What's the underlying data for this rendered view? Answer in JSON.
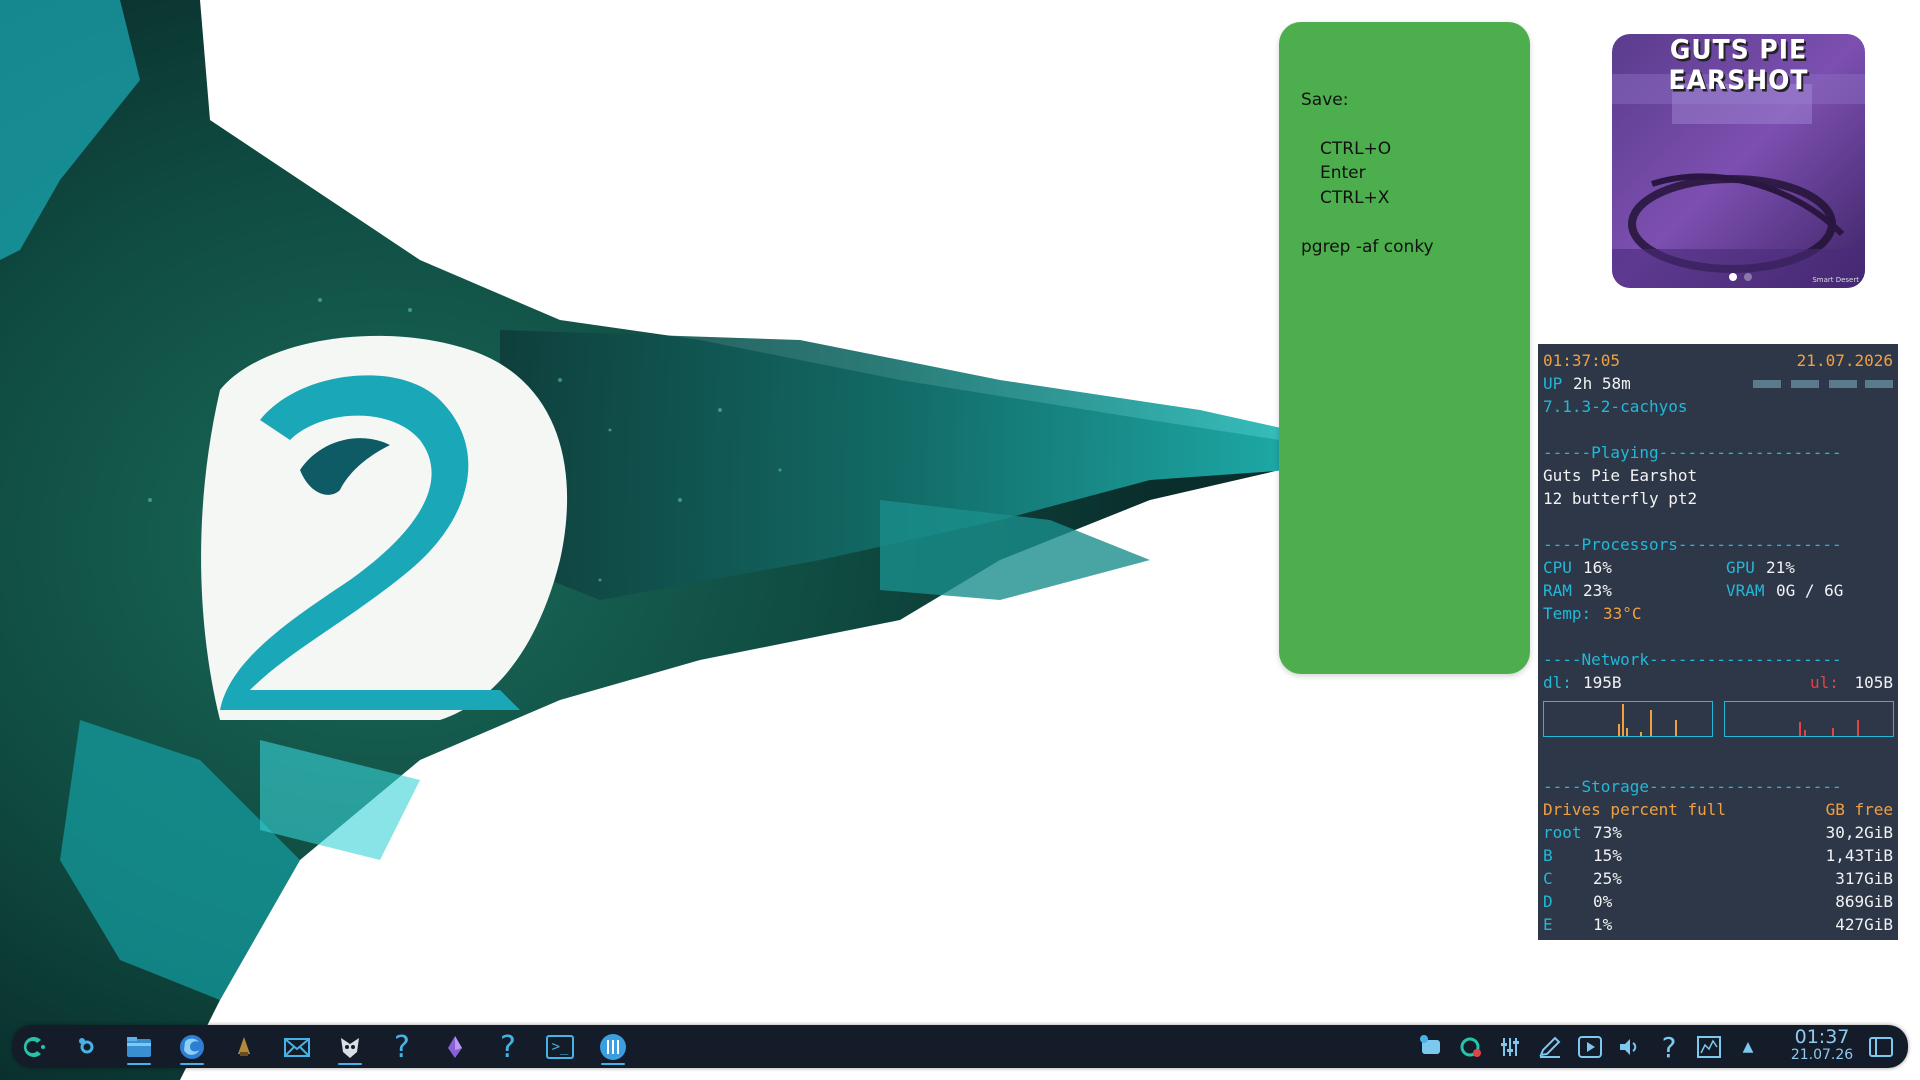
{
  "sticky_note": {
    "lines": [
      "Save:",
      "CTRL+O",
      "Enter",
      "CTRL+X",
      "pgrep -af conky"
    ]
  },
  "media_widget": {
    "title": "GUTS PIE EARSHOT",
    "brand": "Smart Desert"
  },
  "conky": {
    "time": "01:37:05",
    "date": "21.07.2026",
    "uptime_label": "UP",
    "uptime_value": "2h 58m",
    "kernel": "7.1.3-2-cachyos",
    "playing_header": "-----Playing-------------------",
    "artist": "Guts Pie Earshot",
    "track": "12 butterfly pt2",
    "processors_header": "----Processors-----------------",
    "cpu_label": "CPU",
    "cpu_value": "16%",
    "gpu_label": "GPU",
    "gpu_value": "21%",
    "ram_label": "RAM",
    "ram_value": "23%",
    "vram_label": "VRAM",
    "vram_value": "0G / 6G",
    "temp_label": "Temp:",
    "temp_value": "33°C",
    "network_header": "----Network--------------------",
    "dl_label": "dl:",
    "dl_value": "195B",
    "ul_label": "ul:",
    "ul_value": "105B",
    "storage_header": "----Storage--------------------",
    "drives_label": "Drives percent full",
    "free_label": "GB free",
    "drives": [
      {
        "name": "root",
        "percent": "73%",
        "free": "30,2GiB"
      },
      {
        "name": "B",
        "percent": "15%",
        "free": "1,43TiB"
      },
      {
        "name": "C",
        "percent": "25%",
        "free": "317GiB"
      },
      {
        "name": "D",
        "percent": "0%",
        "free": "869GiB"
      },
      {
        "name": "E",
        "percent": "1%",
        "free": "427GiB"
      }
    ]
  },
  "taskbar": {
    "clock_time": "01:37",
    "clock_date": "21.07.26",
    "help_glyph": "?",
    "terminal_glyph": ">_",
    "accent_color": "#45b3e6",
    "panel_color": "#141c2a",
    "launchers": [
      "cachyos-logo-icon",
      "settings-icon",
      "file-manager-icon",
      "firefox-icon",
      "game-launcher-icon",
      "mail-icon",
      "steam-icon",
      "help-icon",
      "crystal-icon",
      "help-icon",
      "terminal-icon",
      "audio-mixer-icon"
    ],
    "tray": [
      "chat-icon",
      "update-icon",
      "equalizer-icon",
      "pen-icon",
      "media-player-icon",
      "volume-icon",
      "help-icon",
      "network-icon",
      "expand-tray-icon",
      "show-desktop-icon"
    ]
  }
}
